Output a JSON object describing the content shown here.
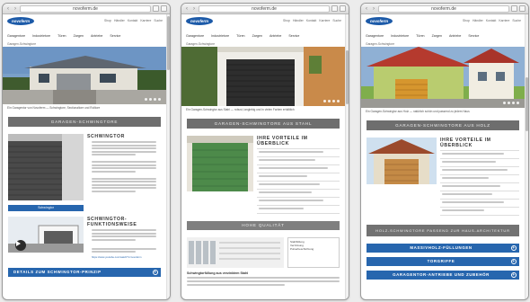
{
  "browser": {
    "url": "novoferm.de",
    "back": "‹",
    "forward": "›"
  },
  "header": {
    "logo": "novoferm",
    "util": [
      "Shop",
      "Händler",
      "Kontakt",
      "Karriere",
      "Suche"
    ],
    "menu": [
      "Garagentore",
      "Industrietore",
      "Türen",
      "Zargen",
      "Antriebe",
      "Service"
    ]
  },
  "panels": [
    {
      "subnav": "Garagen-Schwingtore",
      "caption": "Ein Garagentor von Novoferm — Schwingtore, Sectionaltore und Rolltore",
      "section_bar": "GARAGEN-SCHWINGTORE",
      "heading": "SCHWINGTOR",
      "image_label": "Schwingtor",
      "heading2": "SCHWINGTOR-FUNKTIONSWEISE",
      "link_text": "https://www.youtube.com/watch?v=novoferm",
      "cta": "DETAILS ZUM SCHWINGTOR-PRINZIP"
    },
    {
      "caption": "Ein Garagen-Schwingtor aus Stahl — robust, langlebig und in vielen Farben erhältlich",
      "section_bar": "GARAGEN-SCHWINGTORE AUS STAHL",
      "heading": "IHRE VORTEILE IM ÜBERBLICK",
      "quality_bar": "HOHE QUALITÄT",
      "legend": [
        "Stahlfüllung",
        "Verzinkung",
        "Pulverbeschichtung"
      ],
      "image_title": "Schwingtorfüllung aus verzinktem Stahl"
    },
    {
      "caption": "Ein Garagen-Schwingtor aus Holz — natürlich schön und passend zu jedem Haus",
      "section_bar": "GARAGEN-SCHWINGTORE AUS HOLZ",
      "heading": "IHRE VORTEILE IM ÜBERBLICK",
      "bar2": "HOLZ-SCHWINGTORE PASSEND ZUR HAUS-ARCHITEKTUR",
      "ctas": [
        "MASSIVHOLZ-FÜLLUNGEN",
        "TORGRIFFE",
        "GARAGENTOR-ANTRIEBE UND ZUBEHÖR"
      ]
    }
  ],
  "colors": {
    "accent_blue": "#2766ae",
    "bar_gray": "#6e6e6e"
  },
  "icons": {
    "plus": "+"
  }
}
